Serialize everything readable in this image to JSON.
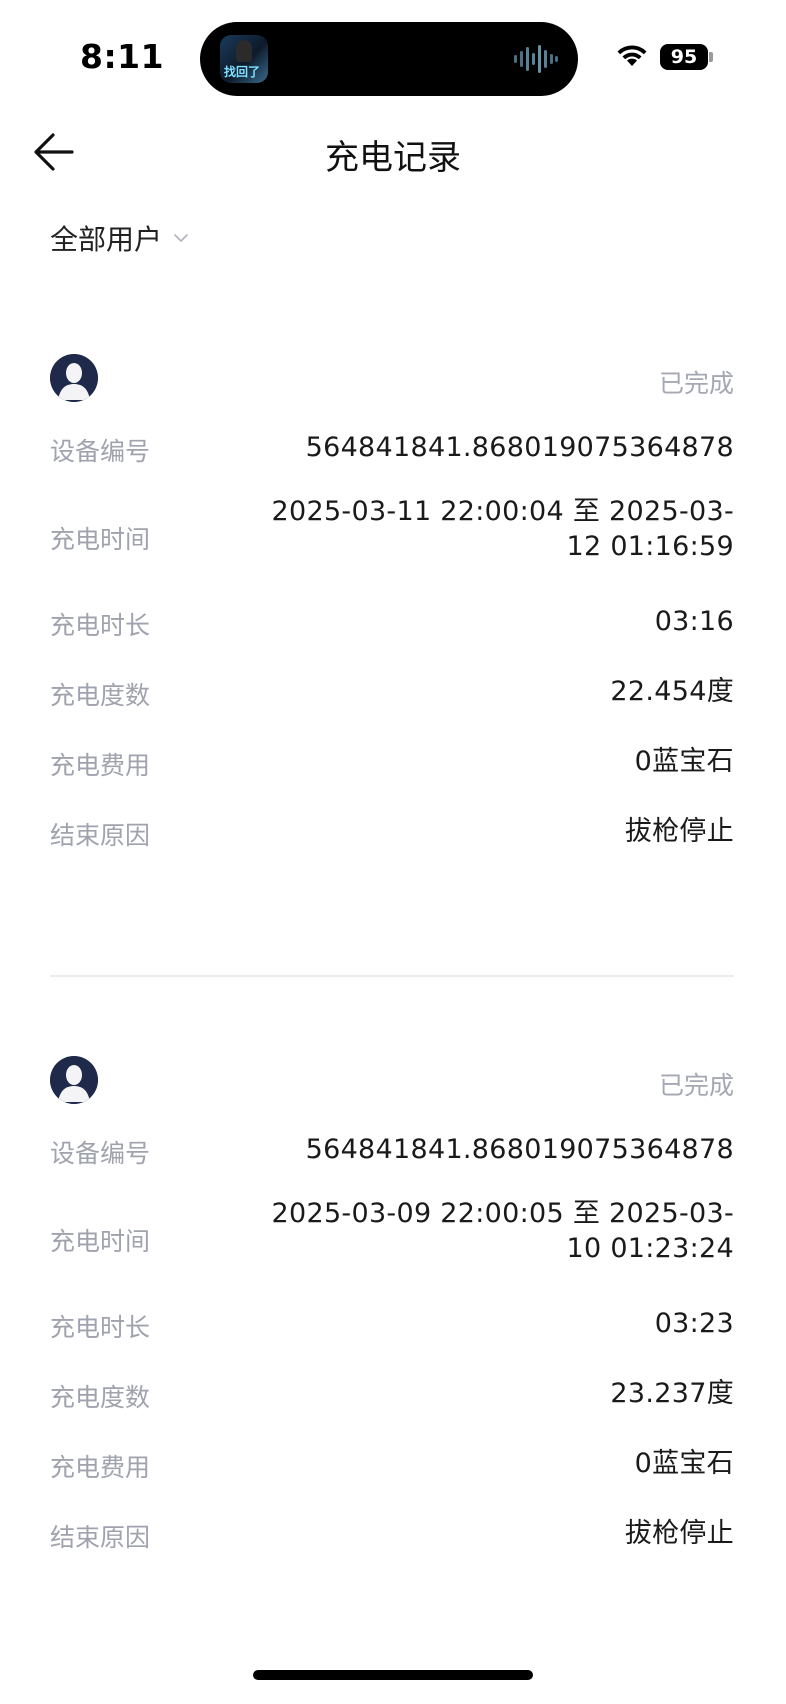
{
  "status_bar": {
    "time": "8:11",
    "battery": "95",
    "island_app_text": "找回了"
  },
  "nav": {
    "title": "充电记录"
  },
  "filter": {
    "label": "全部用户"
  },
  "labels": {
    "device_id": "设备编号",
    "charge_time": "充电时间",
    "duration": "充电时长",
    "energy": "充电度数",
    "cost": "充电费用",
    "end_reason": "结束原因"
  },
  "records": [
    {
      "status": "已完成",
      "device_id": "564841841.868019075364878",
      "charge_time_line1": "2025-03-11 22:00:04 至 2025-03-",
      "charge_time_line2": "12 01:16:59",
      "duration": "03:16",
      "energy": "22.454度",
      "cost": "0蓝宝石",
      "end_reason": "拔枪停止"
    },
    {
      "status": "已完成",
      "device_id": "564841841.868019075364878",
      "charge_time_line1": "2025-03-09 22:00:05 至 2025-03-",
      "charge_time_line2": "10 01:23:24",
      "duration": "03:23",
      "energy": "23.237度",
      "cost": "0蓝宝石",
      "end_reason": "拔枪停止"
    }
  ]
}
